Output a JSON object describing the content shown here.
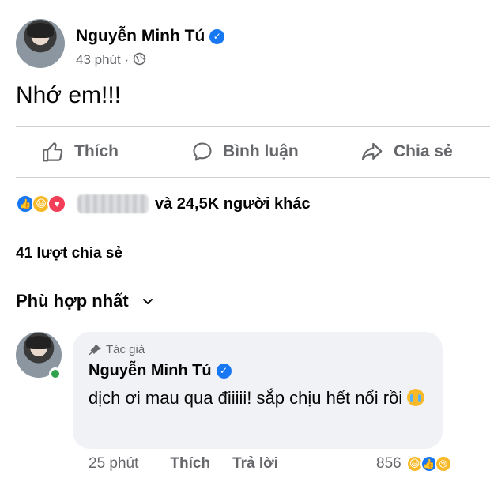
{
  "post": {
    "author": "Nguyễn Minh Tú",
    "time": "43 phút",
    "separator": "·",
    "text": "Nhớ em!!!"
  },
  "actions": {
    "like": "Thích",
    "comment": "Bình luận",
    "share": "Chia sẻ"
  },
  "reactions": {
    "summary": "và 24,5K người khác",
    "icons": [
      "like-icon",
      "haha-icon",
      "love-icon"
    ]
  },
  "shares": "41 lượt chia sẻ",
  "sort": {
    "label": "Phù hợp nhất"
  },
  "comment": {
    "badge": "Tác giả",
    "author": "Nguyễn Minh Tú",
    "text": "dịch ơi mau qua điiiii! sắp chịu hết nổi rồi",
    "time": "25 phút",
    "like": "Thích",
    "reply": "Trả lời",
    "reaction_count": "856",
    "reaction_icons": [
      "haha-icon",
      "like-icon",
      "sad-icon"
    ]
  },
  "colors": {
    "accent": "#1877f2",
    "muted_text": "#65676b",
    "bubble": "#f0f2f5",
    "online": "#31a24c"
  }
}
